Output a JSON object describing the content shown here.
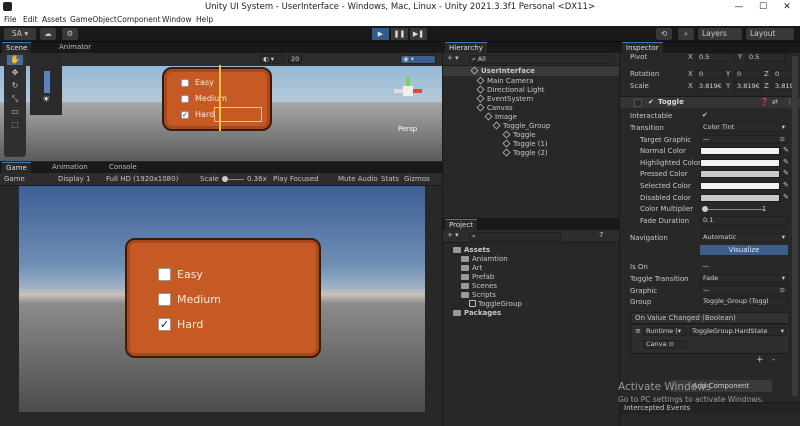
{
  "window": {
    "title": "Unity UI System - UserInterface - Windows, Mac, Linux - Unity 2021.3.3f1 Personal <DX11>",
    "minimize": "—",
    "maximize": "☐",
    "close": "✕"
  },
  "menu": [
    "File",
    "Edit",
    "Assets",
    "GameObject",
    "Component",
    "Window",
    "Help"
  ],
  "toolbar": {
    "account": "SA ▾",
    "layers": "Layers",
    "layout": "Layout",
    "play": "▶",
    "pause": "❚❚",
    "step": "▶❚"
  },
  "scene": {
    "tabs": [
      "Scene",
      "Animator"
    ],
    "zoom": "20",
    "persp": "Persp",
    "toggles": [
      "Easy",
      "Medium",
      "Hard"
    ]
  },
  "game": {
    "tabs": [
      "Game",
      "Animation",
      "Console"
    ],
    "mode": "Game",
    "display": "Display 1",
    "resolution": "Full HD (1920x1080)",
    "scale_label": "Scale",
    "scale_value": "0.36x",
    "play_focused": "Play Focused",
    "mute": "Mute Audio",
    "stats": "Stats",
    "gizmos": "Gizmos",
    "toggles": [
      {
        "label": "Easy",
        "checked": false
      },
      {
        "label": "Medium",
        "checked": false
      },
      {
        "label": "Hard",
        "checked": true
      }
    ]
  },
  "hierarchy": {
    "tab": "Hierarchy",
    "search_placeholder": "All",
    "items": [
      {
        "label": "UserInterface",
        "level": 0,
        "bold": true
      },
      {
        "label": "Main Camera",
        "level": 1
      },
      {
        "label": "Directional Light",
        "level": 1
      },
      {
        "label": "EventSystem",
        "level": 1
      },
      {
        "label": "Canvas",
        "level": 1
      },
      {
        "label": "Image",
        "level": 2
      },
      {
        "label": "Toggle_Group",
        "level": 3
      },
      {
        "label": "Toggle",
        "level": 4
      },
      {
        "label": "Toggle (1)",
        "level": 4
      },
      {
        "label": "Toggle (2)",
        "level": 4
      }
    ]
  },
  "project": {
    "tab": "Project",
    "count": "7",
    "items": [
      {
        "label": "Assets",
        "level": 0,
        "bold": true
      },
      {
        "label": "Aniamtion",
        "level": 1
      },
      {
        "label": "Art",
        "level": 1
      },
      {
        "label": "Prefab",
        "level": 1
      },
      {
        "label": "Scenes",
        "level": 1
      },
      {
        "label": "Scripts",
        "level": 1
      },
      {
        "label": "ToggleGroup",
        "level": 2
      },
      {
        "label": "Packages",
        "level": 0,
        "bold": true
      }
    ]
  },
  "inspector": {
    "tab": "Inspector",
    "pivot": {
      "label": "Pivot",
      "x": "0.5",
      "y": "0.5"
    },
    "rotation": {
      "label": "Rotation",
      "x": "0",
      "y": "0",
      "z": "0"
    },
    "scale": {
      "label": "Scale",
      "x": "3.819€",
      "y": "3.819€",
      "z": "3.819€"
    },
    "component": "Toggle",
    "interactable": "Interactable",
    "transition": {
      "label": "Transition",
      "value": "Color Tint"
    },
    "target_graphic": {
      "label": "Target Graphic",
      "value": "—"
    },
    "normal_color": "Normal Color",
    "highlighted_color": "Highlighted Color",
    "pressed_color": "Pressed Color",
    "selected_color": "Selected Color",
    "disabled_color": "Disabled Color",
    "color_multiplier": {
      "label": "Color Multiplier",
      "value": "1"
    },
    "fade_duration": {
      "label": "Fade Duration",
      "value": "0.1"
    },
    "navigation": {
      "label": "Navigation",
      "value": "Automatic"
    },
    "visualize": "Visualize",
    "is_on": "Is On",
    "toggle_transition": {
      "label": "Toggle Transition",
      "value": "Fade"
    },
    "graphic": {
      "label": "Graphic",
      "value": "—"
    },
    "group": {
      "label": "Group",
      "value": "Toggle_Group (Toggl"
    },
    "event": "On Value Changed (Boolean)",
    "runtime": "Runtime (▾",
    "function": "ToggleGroup.HardState",
    "object": "Canva",
    "add_component": "Add Component",
    "intercepted": "Intercepted Events",
    "plus": "+",
    "minus": "-"
  },
  "watermark": {
    "line1": "Activate Windows",
    "line2": "Go to PC settings to activate Windows."
  }
}
